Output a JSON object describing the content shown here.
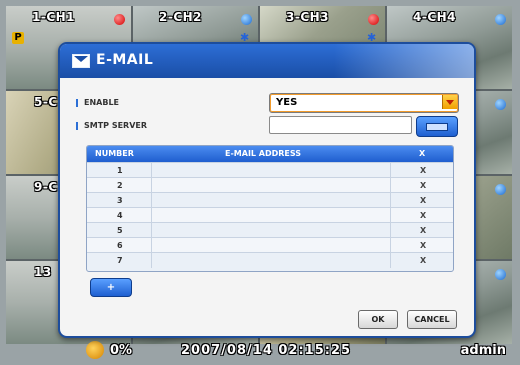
{
  "cameras": [
    {
      "label": "1-CH1",
      "dot": "red",
      "badge": "P"
    },
    {
      "label": "2-CH2",
      "dot": "blue"
    },
    {
      "label": "3-CH3",
      "dot": "red"
    },
    {
      "label": "4-CH4",
      "dot": "blue"
    },
    {
      "label": "5-C",
      "dot": "blue"
    },
    {
      "label": "",
      "dot": ""
    },
    {
      "label": "",
      "dot": ""
    },
    {
      "label": "",
      "dot": "blue"
    },
    {
      "label": "9-C",
      "dot": "blue"
    },
    {
      "label": "",
      "dot": ""
    },
    {
      "label": "",
      "dot": ""
    },
    {
      "label": "",
      "dot": "blue"
    },
    {
      "label": "13",
      "dot": "blue"
    },
    {
      "label": "",
      "dot": ""
    },
    {
      "label": "",
      "dot": ""
    },
    {
      "label": "",
      "dot": "blue"
    }
  ],
  "status": {
    "volume": "0%",
    "datetime": "2007/08/14  02:15:25",
    "user": "admin"
  },
  "dialog": {
    "title": "E-MAIL",
    "enable_label": "ENABLE",
    "enable_value": "YES",
    "smtp_label": "SMTP SERVER",
    "smtp_value": "",
    "table_headers": [
      "NUMBER",
      "E-MAIL ADDRESS",
      "X"
    ],
    "rows": [
      {
        "number": "1",
        "address": "",
        "remove": "X"
      },
      {
        "number": "2",
        "address": "",
        "remove": "X"
      },
      {
        "number": "3",
        "address": "",
        "remove": "X"
      },
      {
        "number": "4",
        "address": "",
        "remove": "X"
      },
      {
        "number": "5",
        "address": "",
        "remove": "X"
      },
      {
        "number": "6",
        "address": "",
        "remove": "X"
      },
      {
        "number": "7",
        "address": "",
        "remove": "X"
      }
    ],
    "add_label": "+",
    "ok_label": "OK",
    "cancel_label": "CANCEL"
  },
  "colors": {
    "dialog_header": "#1a4ea6",
    "table_header": "#2b6fd6",
    "select_accent": "#f0a000",
    "dot_red": "#d40000",
    "dot_blue": "#1b6ad1"
  },
  "icons": {
    "header": "mail-icon",
    "volume": "speaker-icon",
    "keyboard": "keyboard-icon",
    "motion": "running-person-icon",
    "record": "record-dot-icon"
  }
}
